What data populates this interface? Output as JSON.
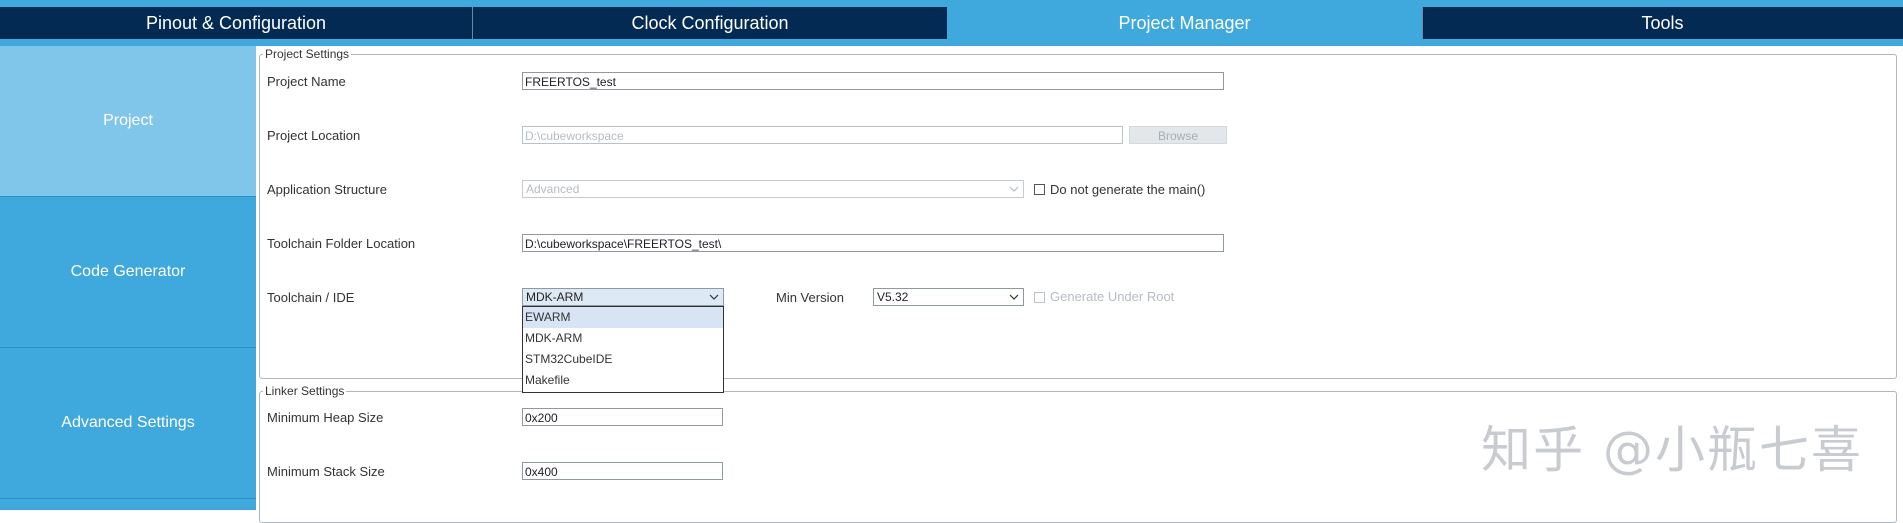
{
  "tabs": [
    {
      "label": "Pinout & Configuration"
    },
    {
      "label": "Clock Configuration"
    },
    {
      "label": "Project Manager"
    },
    {
      "label": "Tools"
    }
  ],
  "sidebar": {
    "items": [
      {
        "label": "Project"
      },
      {
        "label": "Code Generator"
      },
      {
        "label": "Advanced Settings"
      }
    ]
  },
  "project_settings": {
    "legend": "Project Settings",
    "project_name_label": "Project Name",
    "project_name_value": "FREERTOS_test",
    "project_location_label": "Project Location",
    "project_location_value": "D:\\cubeworkspace",
    "browse_label": "Browse",
    "app_structure_label": "Application Structure",
    "app_structure_value": "Advanced",
    "no_main_label": "Do not generate the main()",
    "toolchain_folder_label": "Toolchain Folder Location",
    "toolchain_folder_value": "D:\\cubeworkspace\\FREERTOS_test\\",
    "toolchain_ide_label": "Toolchain / IDE",
    "toolchain_ide_value": "MDK-ARM",
    "min_version_label": "Min Version",
    "min_version_value": "V5.32",
    "generate_under_root_label": "Generate Under Root",
    "toolchain_options": [
      "EWARM",
      "MDK-ARM",
      "STM32CubeIDE",
      "Makefile"
    ]
  },
  "linker_settings": {
    "legend": "Linker Settings",
    "min_heap_label": "Minimum Heap Size",
    "min_heap_value": "0x200",
    "min_stack_label": "Minimum Stack Size",
    "min_stack_value": "0x400"
  },
  "watermark": "知乎 @小瓶七喜",
  "colors": {
    "tab_bg": "#032a52",
    "accent": "#3fa9dd",
    "sidebar_active": "#7fc6ea"
  }
}
